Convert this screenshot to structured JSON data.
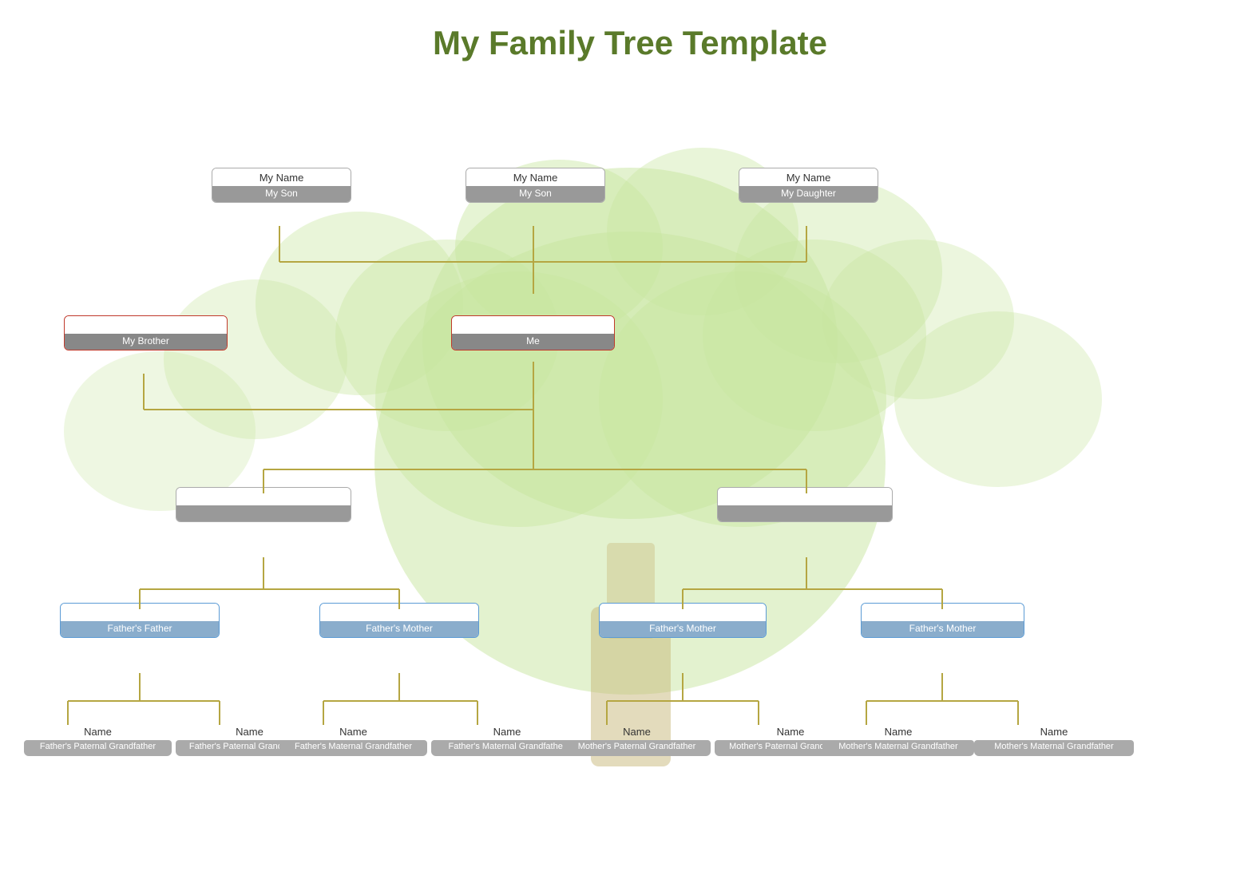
{
  "title": "My Family Tree Template",
  "nodes": {
    "son1": {
      "name": "My Name",
      "role": "My Son"
    },
    "son2": {
      "name": "My Name",
      "role": "My Son"
    },
    "daughter": {
      "name": "My Name",
      "role": "My Daughter"
    },
    "me": {
      "name": "",
      "role": "Me"
    },
    "brother": {
      "name": "",
      "role": "My Brother"
    },
    "father": {
      "name": "",
      "role": ""
    },
    "mother": {
      "name": "",
      "role": ""
    },
    "fathers_father": {
      "name": "Father's Father",
      "role": ""
    },
    "fathers_mother_pat": {
      "name": "Father's Mother",
      "role": ""
    },
    "fathers_mother_mat": {
      "name": "Father's Mother",
      "role": ""
    },
    "mothers_mother": {
      "name": "Father's Mother",
      "role": ""
    },
    "ggp1_name": "Name",
    "ggp1_role": "Father's Paternal Grandfather",
    "ggp2_name": "Name",
    "ggp2_role": "Father's Paternal Grandmother",
    "ggp3_name": "Name",
    "ggp3_role": "Father's Maternal Grandfather",
    "ggp4_name": "Name",
    "ggp4_role": "Father's Maternal Grandfather",
    "ggp5_name": "Name",
    "ggp5_role": "Mother's Paternal Grandfather",
    "ggp6_name": "Name",
    "ggp6_role": "Mother's Paternal Grandmother",
    "ggp7_name": "Name",
    "ggp7_role": "Mother's Maternal Grandfather",
    "ggp8_name": "Name",
    "ggp8_role": "Mother's Maternal Grandfather"
  }
}
